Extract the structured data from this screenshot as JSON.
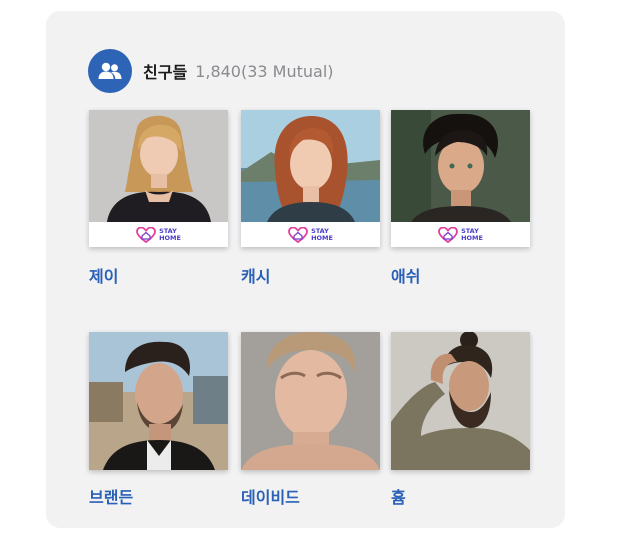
{
  "header": {
    "icon": "friends-icon",
    "title": "친구들",
    "count": "1,840(33 Mutual)"
  },
  "colors": {
    "accent": "#2e64b6",
    "name_link": "#2a60b6",
    "badge_pink": "#e0409a",
    "badge_purple": "#4a3ec8"
  },
  "friends": [
    {
      "name": "제이",
      "badge": {
        "line1": "STAY",
        "line2": "HOME"
      }
    },
    {
      "name": "캐시",
      "badge": {
        "line1": "STAY",
        "line2": "HOME"
      }
    },
    {
      "name": "애쉬",
      "badge": {
        "line1": "STAY",
        "line2": "HOME"
      }
    },
    {
      "name": "브랜든"
    },
    {
      "name": "데이비드"
    },
    {
      "name": "흄"
    }
  ]
}
